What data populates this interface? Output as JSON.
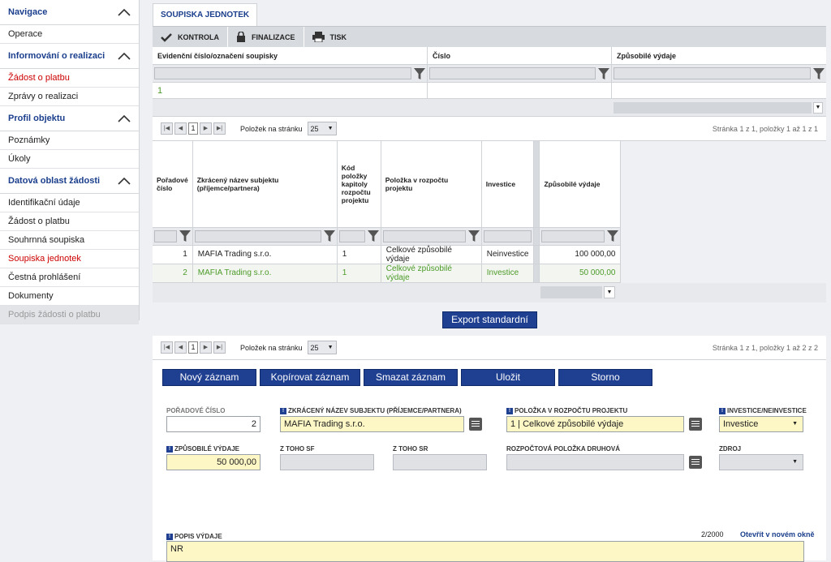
{
  "sidebar": {
    "sections": [
      {
        "title": "Navigace",
        "items": [
          {
            "label": "Operace",
            "style": "normal"
          }
        ]
      },
      {
        "title": "Informování o realizaci",
        "items": [
          {
            "label": "Žádost o platbu",
            "style": "red"
          },
          {
            "label": "Zprávy o realizaci",
            "style": "normal"
          }
        ]
      },
      {
        "title": "Profil objektu",
        "items": [
          {
            "label": "Poznámky",
            "style": "normal"
          },
          {
            "label": "Úkoly",
            "style": "normal"
          }
        ]
      },
      {
        "title": "Datová oblast žádosti",
        "items": [
          {
            "label": "Identifikační údaje",
            "style": "normal"
          },
          {
            "label": "Žádost o platbu",
            "style": "normal"
          },
          {
            "label": "Souhrnná soupiska",
            "style": "normal"
          },
          {
            "label": "Soupiska jednotek",
            "style": "red"
          },
          {
            "label": "Čestná prohlášení",
            "style": "normal"
          },
          {
            "label": "Dokumenty",
            "style": "normal"
          },
          {
            "label": "Podpis žádosti o platbu",
            "style": "disabled"
          }
        ]
      }
    ]
  },
  "tab": {
    "label": "SOUPISKA JEDNOTEK"
  },
  "toolbar": {
    "kontrola": "KONTROLA",
    "finalizace": "FINALIZACE",
    "tisk": "TISK"
  },
  "grid1": {
    "columns": [
      "Evidenční číslo/označení soupisky",
      "Číslo",
      "Způsobilé výdaje"
    ],
    "rows": [
      [
        "1",
        "",
        ""
      ]
    ]
  },
  "pager1": {
    "page": "1",
    "label": "Položek na stránku",
    "size": "25",
    "info": "Stránka 1 z 1, položky 1 až 1 z 1"
  },
  "grid2": {
    "columns": [
      "Pořadové číslo",
      "Zkrácený název subjektu (příjemce/partnera)",
      "Kód položky kapitoly rozpočtu projektu",
      "Položka v rozpočtu projektu",
      "Investice",
      "Způsobilé výdaje"
    ],
    "rows": [
      {
        "num": "1",
        "name": "MAFIA Trading s.r.o.",
        "code": "1",
        "item": "Celkové způsobilé výdaje",
        "inv": "Neinvestice",
        "amount": "100 000,00"
      },
      {
        "num": "2",
        "name": "MAFIA Trading s.r.o.",
        "code": "1",
        "item": "Celkové způsobilé výdaje",
        "inv": "Investice",
        "amount": "50 000,00"
      }
    ]
  },
  "export": {
    "label": "Export standardní"
  },
  "pager2": {
    "page": "1",
    "label": "Položek na stránku",
    "size": "25",
    "info": "Stránka 1 z 1, položky 1 až 2 z 2"
  },
  "actions": {
    "new": "Nový záznam",
    "copy": "Kopírovat záznam",
    "delete": "Smazat záznam",
    "save": "Uložit",
    "cancel": "Storno"
  },
  "form": {
    "poradove_label": "POŘADOVÉ ČÍSLO",
    "poradove_value": "2",
    "subjekt_label": "ZKRÁCENÝ NÁZEV SUBJEKTU (PŘÍJEMCE/PARTNERA)",
    "subjekt_value": "MAFIA Trading s.r.o.",
    "polozka_label": "POLOŽKA V ROZPOČTU PROJEKTU",
    "polozka_value": "1 | Celkové způsobilé výdaje",
    "investice_label": "INVESTICE/NEINVESTICE",
    "investice_value": "Investice",
    "vydaje_label": "ZPŮSOBILÉ VÝDAJE",
    "vydaje_value": "50 000,00",
    "sf_label": "Z TOHO SF",
    "sr_label": "Z TOHO SR",
    "druhova_label": "ROZPOČTOVÁ POLOŽKA DRUHOVÁ",
    "zdroj_label": "ZDROJ",
    "popis_label": "POPIS VÝDAJE",
    "popis_counter": "2/2000",
    "popis_link": "Otevřít v novém okně",
    "popis_value": "NR"
  }
}
